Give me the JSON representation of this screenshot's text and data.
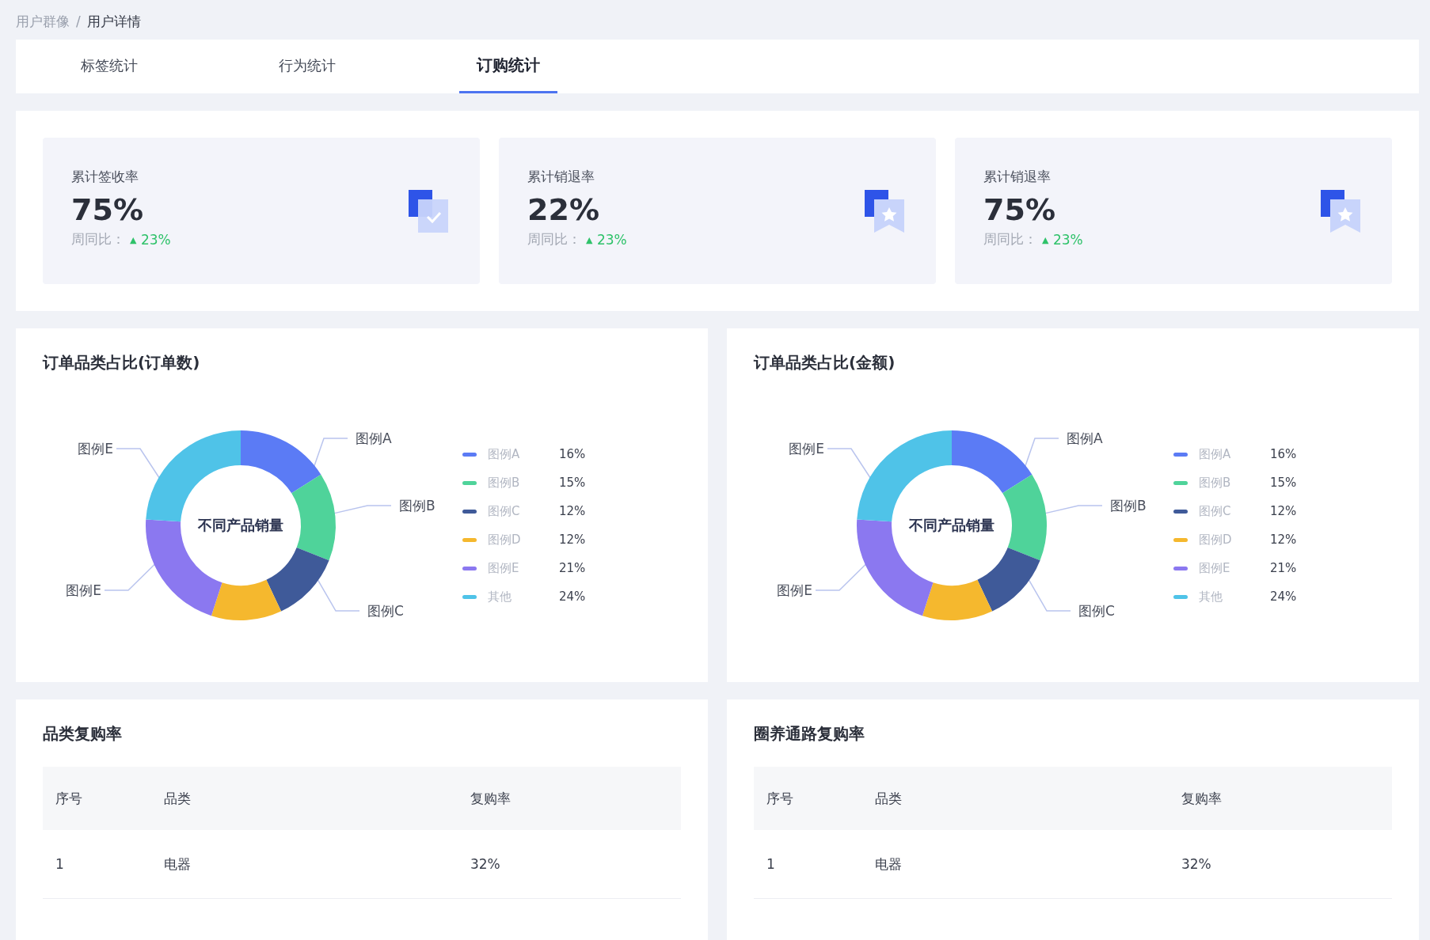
{
  "breadcrumb": {
    "separator": "/",
    "items": [
      {
        "label": "用户群像",
        "current": false
      },
      {
        "label": "用户详情",
        "current": true
      }
    ]
  },
  "tabs": [
    {
      "label": "标签统计",
      "selected": false
    },
    {
      "label": "行为统计",
      "selected": false
    },
    {
      "label": "订购统计",
      "selected": true
    }
  ],
  "kpis": [
    {
      "label": "累计签收率",
      "value": "75%",
      "compare_label": "周同比：",
      "arrow": "▲",
      "change": "23%"
    },
    {
      "label": "累计销退率",
      "value": "22%",
      "compare_label": "周同比：",
      "arrow": "▲",
      "change": "23%"
    },
    {
      "label": "累计销退率",
      "value": "75%",
      "compare_label": "周同比：",
      "arrow": "▲",
      "change": "23%"
    }
  ],
  "charts": [
    {
      "title": "订单品类占比(订单数)",
      "center_label": "不同产品销量",
      "callouts": [
        "图例E",
        "图例A",
        "图例B",
        "图例E",
        "图例C"
      ],
      "legend": [
        {
          "color": "#5b7bf5"
        },
        {
          "color": "#4fd39a"
        },
        {
          "color": "#3f5a99"
        },
        {
          "color": "#f5b82e"
        },
        {
          "color": "#8b78f0"
        },
        {
          "color": "#4fc3e8"
        }
      ],
      "chart_data": {
        "type": "donut",
        "categories": [
          "图例A",
          "图例B",
          "图例C",
          "图例D",
          "图例E",
          "其他"
        ],
        "values": [
          16,
          15,
          12,
          12,
          21,
          24
        ],
        "value_labels": [
          "16%",
          "15%",
          "12%",
          "12%",
          "21%",
          "24%"
        ]
      }
    },
    {
      "title": "订单品类占比(金额)",
      "center_label": "不同产品销量",
      "callouts": [
        "图例E",
        "图例A",
        "图例B",
        "图例E",
        "图例C"
      ],
      "legend": [
        {
          "color": "#5b7bf5"
        },
        {
          "color": "#4fd39a"
        },
        {
          "color": "#3f5a99"
        },
        {
          "color": "#f5b82e"
        },
        {
          "color": "#8b78f0"
        },
        {
          "color": "#4fc3e8"
        }
      ],
      "chart_data": {
        "type": "donut",
        "categories": [
          "图例A",
          "图例B",
          "图例C",
          "图例D",
          "图例E",
          "其他"
        ],
        "values": [
          16,
          15,
          12,
          12,
          21,
          24
        ],
        "value_labels": [
          "16%",
          "15%",
          "12%",
          "12%",
          "21%",
          "24%"
        ]
      }
    }
  ],
  "tables": [
    {
      "title": "品类复购率",
      "columns": [
        "序号",
        "品类",
        "复购率"
      ],
      "rows": [
        [
          "1",
          "电器",
          "32%"
        ]
      ]
    },
    {
      "title": "圈养通路复购率",
      "columns": [
        "序号",
        "品类",
        "复购率"
      ],
      "rows": [
        [
          "1",
          "电器",
          "32%"
        ]
      ]
    }
  ]
}
